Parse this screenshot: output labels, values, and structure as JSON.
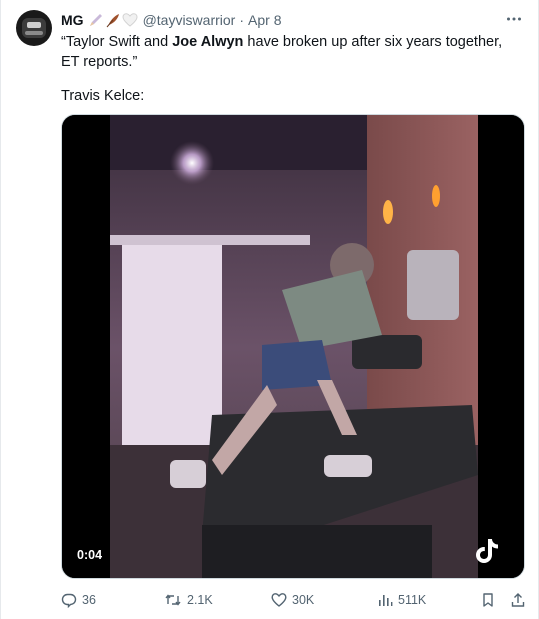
{
  "author": {
    "name": "MG",
    "handle": "@tayviswarrior",
    "separator": "·",
    "date": "Apr 8",
    "name_emojis": [
      "pen-emoji",
      "feather-emoji",
      "white-heart-emoji"
    ]
  },
  "tweet": {
    "text_open": "“Taylor Swift and ",
    "text_bold": "Joe Alwyn",
    "text_rest": " have broken up after six years together, ET reports.”",
    "line2": "Travis Kelce:"
  },
  "media": {
    "timestamp": "0:04",
    "watermark_icon": "tiktok-icon"
  },
  "actions": {
    "reply_count": "36",
    "retweet_count": "2.1K",
    "like_count": "30K",
    "views_count": "511K"
  },
  "colors": {
    "text_primary": "#0f1419",
    "text_secondary": "#536471",
    "border": "#cfd9de"
  }
}
